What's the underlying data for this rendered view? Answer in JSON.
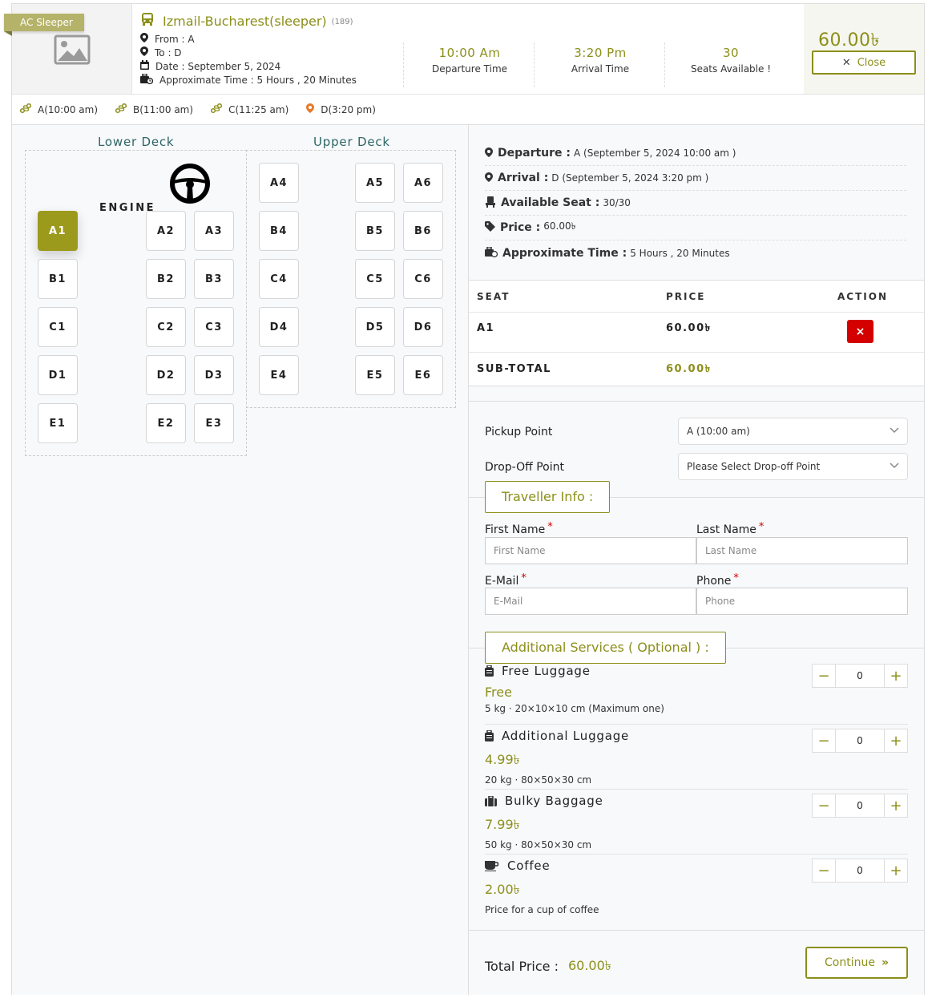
{
  "header": {
    "badge": "AC Sleeper",
    "title": "Izmail-Bucharest(sleeper)",
    "code": "(189)",
    "from": "From : A",
    "to": "To : D",
    "date": "Date : September 5, 2024",
    "approx": "Approximate Time : 5 Hours , 20 Minutes",
    "departure_time": "10:00 Am",
    "departure_label": "Departure Time",
    "arrival_time": "3:20 Pm",
    "arrival_label": "Arrival Time",
    "seats_count": "30",
    "seats_label": "Seats Available !",
    "price": "60.00৳",
    "close_label": "Close"
  },
  "stops": [
    "A(10:00 am)",
    "B(11:00 am)",
    "C(11:25 am)",
    "D(3:20 pm)"
  ],
  "layout": {
    "lower_title": "Lower Deck",
    "upper_title": "Upper Deck",
    "engine_label": "ENGINE",
    "selected_seat": "A1",
    "lower_rows": [
      [
        "A1",
        "",
        "A2",
        "A3"
      ],
      [
        "B1",
        "",
        "B2",
        "B3"
      ],
      [
        "C1",
        "",
        "C2",
        "C3"
      ],
      [
        "D1",
        "",
        "D2",
        "D3"
      ],
      [
        "E1",
        "",
        "E2",
        "E3"
      ]
    ],
    "upper_rows": [
      [
        "A4",
        "",
        "A5",
        "A6"
      ],
      [
        "B4",
        "",
        "B5",
        "B6"
      ],
      [
        "C4",
        "",
        "C5",
        "C6"
      ],
      [
        "D4",
        "",
        "D5",
        "D6"
      ],
      [
        "E4",
        "",
        "E5",
        "E6"
      ]
    ]
  },
  "details": {
    "departure_key": "Departure :",
    "departure_val": "A (September 5, 2024 10:00 am )",
    "arrival_key": "Arrival :",
    "arrival_val": "D (September 5, 2024 3:20 pm )",
    "avail_key": "Available Seat :",
    "avail_val": "30/30",
    "price_key": "Price :",
    "price_val": "60.00৳",
    "approx_key": "Approximate Time :",
    "approx_val": "5 Hours , 20 Minutes"
  },
  "table": {
    "col_seat": "SEAT",
    "col_price": "PRICE",
    "col_action": "ACTION",
    "row_seat": "A1",
    "row_price": "60.00৳",
    "remove_label": "×",
    "subtotal_label": "SUB-TOTAL",
    "subtotal_value": "60.00৳"
  },
  "points": {
    "pickup_label": "Pickup Point",
    "pickup_value": "A (10:00 am)",
    "dropoff_label": "Drop-Off Point",
    "dropoff_value": "Please Select Drop-off Point"
  },
  "traveller": {
    "section_title": "Traveller Info :",
    "first_label": "First Name",
    "first_placeholder": "First Name",
    "last_label": "Last Name",
    "last_placeholder": "Last Name",
    "email_label": "E-Mail",
    "email_placeholder": "E-Mail",
    "phone_label": "Phone",
    "phone_placeholder": "Phone",
    "required_mark": "*"
  },
  "services": {
    "section_title": "Additional Services ( Optional ) :",
    "items": [
      {
        "name": "Free Luggage",
        "price": "Free",
        "desc": "5 kg · 20×10×10 cm (Maximum one)",
        "qty": "0"
      },
      {
        "name": "Additional Luggage",
        "price": "4.99৳",
        "desc": "20 kg · 80×50×30 cm",
        "qty": "0"
      },
      {
        "name": "Bulky Baggage",
        "price": "7.99৳",
        "desc": "50 kg · 80×50×30 cm",
        "qty": "0"
      },
      {
        "name": "Coffee",
        "price": "2.00৳",
        "desc": "Price for a cup of coffee",
        "qty": "0"
      }
    ],
    "minus": "−",
    "plus": "+"
  },
  "footer": {
    "total_label": "Total Price :",
    "total_value": "60.00৳",
    "continue_label": "Continue"
  },
  "colors": {
    "accent": "#8c8f1a",
    "selected_seat": "#9c9a1d",
    "remove": "#d40000",
    "teal_title": "#2e6565"
  }
}
